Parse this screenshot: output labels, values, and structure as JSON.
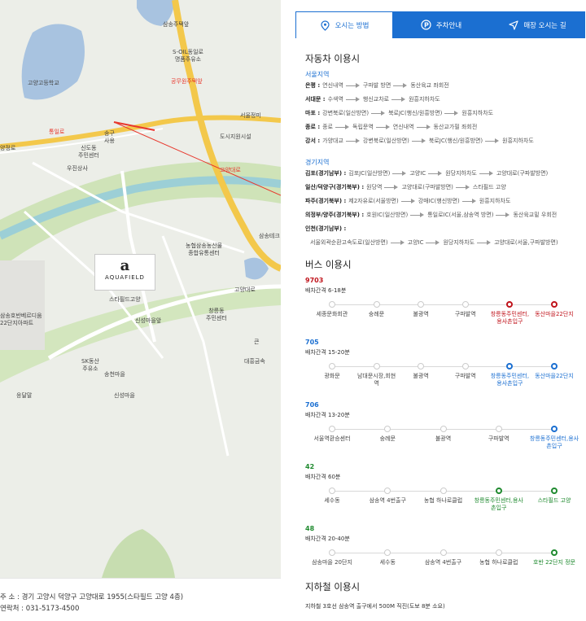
{
  "map": {
    "brand_name": "AQUAFIELD",
    "labels": {
      "samsong_station": "삼송주택앞",
      "soil": "S-OIL동일로\n명품주유소",
      "high_school": "고양고등학교",
      "gongju": "공무원주택앞",
      "seoul_store": "서울정미",
      "dosiji": "도시지원시설",
      "songgu": "송구\n사용",
      "sindong": "신도동\n주민센터",
      "usin": "우진상사",
      "nonghyup": "농협삼송농산물\n종합유통센터",
      "samsongte": "삼송테크",
      "starfield": "스타필드고양",
      "goyangdaero": "고양대로",
      "changreung": "창릉동\n주민센터",
      "sinsong_rd": "신성마을앞",
      "apt": "삼송호반베르디움\n22단지아파트",
      "sk": "SK동산\n주유소",
      "songchun": "송천마을",
      "sinsong": "신성마을",
      "dahmgeum": "대흥금속",
      "keun": "큰",
      "yeongdal": "응달말",
      "yangyang": "양정로",
      "road_red1": "통일로",
      "road_red2": "고양대로"
    }
  },
  "address": {
    "addr": "주 소 : 경기 고양시 덕양구 고양대로 1955(스타필드 고양 4층)",
    "tel": "연락처 : 031-5173-4500"
  },
  "tabs": [
    {
      "label": "오시는 방법",
      "icon": "location-pin-icon",
      "active": true
    },
    {
      "label": "주차안내",
      "icon": "parking-icon",
      "active": false
    },
    {
      "label": "매장 오시는 길",
      "icon": "navigation-arrow-icon",
      "active": false
    }
  ],
  "car": {
    "title": "자동차 이용시",
    "seoul": {
      "region": "서울지역",
      "routes": [
        {
          "label": "은평 :",
          "stops": [
            "연신내역",
            "구파발 방면",
            "동산육교 좌회전"
          ]
        },
        {
          "label": "서대문 :",
          "stops": [
            "수색역",
            "행신교차로",
            "원흥지하차도"
          ]
        },
        {
          "label": "마포 :",
          "stops": [
            "강변북로(일산방면)",
            "북로JC(행신/원흥방면)",
            "원흥지하차도"
          ]
        },
        {
          "label": "종로 :",
          "stops": [
            "종로",
            "독립문역",
            "연신내역",
            "동산교가필 좌회전"
          ]
        },
        {
          "label": "강서 :",
          "stops": [
            "가양대교",
            "강변북로(일산방면)",
            "북로JC(행신/원흥방면)",
            "원흥지하차도"
          ]
        }
      ]
    },
    "gyeonggi": {
      "region": "경기지역",
      "routes": [
        {
          "label": "김포(경기남부) :",
          "stops": [
            "김포JC(일산방면)",
            "고양IC",
            "원당지하차도",
            "고양대로(구파발방면)"
          ]
        },
        {
          "label": "일산/덕양구(경기북부) :",
          "stops": [
            "원당역",
            "고양대로(구파발방면)",
            "스타필드 고양"
          ]
        },
        {
          "label": "파주(경기북부) :",
          "stops": [
            "제2자유로(서울방면)",
            "강매IC(행신방면)",
            "원흥지하차도"
          ]
        },
        {
          "label": "의정부/양주(경기북부) :",
          "stops": [
            "호원IC(일산방면)",
            "통일로IC(서울,삼송역 방면)",
            "동산육교밑 우회전"
          ]
        },
        {
          "label": "인천(경기남부) :",
          "stops": []
        },
        {
          "label": "",
          "stops": [
            "서울외곽순환고속도로(일산방면)",
            "고양IC",
            "원당지하차도",
            "고양대로(서울,구파발방면)"
          ]
        }
      ]
    }
  },
  "bus": {
    "title": "버스 이용시",
    "lines": [
      {
        "num": "9703",
        "color": "#c0141c",
        "interval": "배차간격 6-18분",
        "stops": [
          "세종문화회관",
          "숭례문",
          "불광역",
          "구파발역",
          "창릉동주민센터,\n용사촌입구",
          "동산마을22단지"
        ],
        "hl": [
          4,
          5
        ]
      },
      {
        "num": "705",
        "color": "#1b6fd1",
        "interval": "배차간격 15-20분",
        "stops": [
          "광화문",
          "남대문시장,회현\n역",
          "불광역",
          "구파발역",
          "창릉동주민센터,\n용사촌입구",
          "동산마을22단지"
        ],
        "hl": [
          4,
          5
        ]
      },
      {
        "num": "706",
        "color": "#1b6fd1",
        "interval": "배차간격 13-20분",
        "stops": [
          "서울역환승센터",
          "숭례문",
          "불광역",
          "구파발역",
          "창릉동주민센터,용사\n촌입구"
        ],
        "hl": [
          4
        ]
      },
      {
        "num": "42",
        "color": "#1f8a2f",
        "interval": "배차간격 60분",
        "stops": [
          "세수동",
          "삼송역 4번출구",
          "농협 하나로클럽",
          "창릉동주민센터,용사\n촌입구",
          "스타필드 고양"
        ],
        "hl": [
          3,
          4
        ]
      },
      {
        "num": "48",
        "color": "#1f8a2f",
        "interval": "배차간격 20-40분",
        "stops": [
          "삼송마을 20단지",
          "세수동",
          "삼송역 4번출구",
          "농협 하나로클럽",
          "호반 22단지 정문"
        ],
        "hl": [
          4
        ]
      }
    ]
  },
  "subway": {
    "title": "지하철 이용시",
    "text": "지하철 3호선 삼송역 출구에서 500M 직진(도보 8분 소요)"
  },
  "colors": {
    "accent": "#1b6fd1"
  }
}
